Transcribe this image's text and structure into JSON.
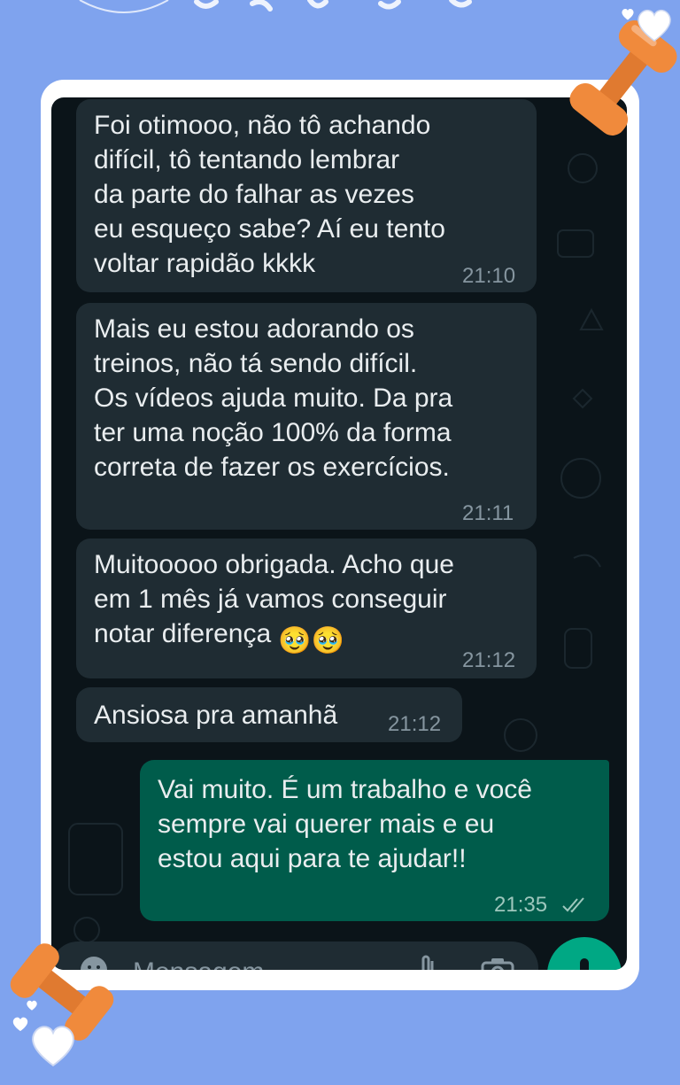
{
  "messages": [
    {
      "direction": "incoming",
      "text": "Foi otimooo, não tô achando\ndifícil, tô tentando lembrar\nda parte do falhar as vezes\neu esqueço sabe? Aí eu tento\nvoltar rapidão kkkk",
      "time": "21:10"
    },
    {
      "direction": "incoming",
      "text": "Mais eu estou adorando os\ntreinos, não tá sendo difícil.\nOs vídeos ajuda muito. Da pra\nter uma noção 100% da forma\ncorreta de fazer os exercícios.",
      "time": "21:11"
    },
    {
      "direction": "incoming",
      "text": "Muitooooo obrigada. Acho que\nem 1 mês já vamos conseguir\nnotar diferença",
      "emoji": "🥹🥹",
      "time": "21:12"
    },
    {
      "direction": "incoming",
      "text": "Ansiosa pra amanhã",
      "time": "21:12"
    },
    {
      "direction": "outgoing",
      "text": "Vai muito. É um trabalho e você\nsempre vai querer mais e eu\nestou aqui para te ajudar!!",
      "time": "21:35",
      "status_icon": "double-check-icon"
    }
  ],
  "composer": {
    "placeholder": "Mensagem"
  },
  "icons": [
    "emoji-icon",
    "attach-icon",
    "camera-icon",
    "mic-icon",
    "dumbbell-icon",
    "heart-icon"
  ],
  "colors": {
    "background": "#7fa3ee",
    "frame": "#ffffff",
    "chat_bg": "#0b1419",
    "incoming_bubble": "#1f2c33",
    "outgoing_bubble": "#005c4b",
    "send_button": "#00a884",
    "dumbbell": "#f08a3c"
  }
}
